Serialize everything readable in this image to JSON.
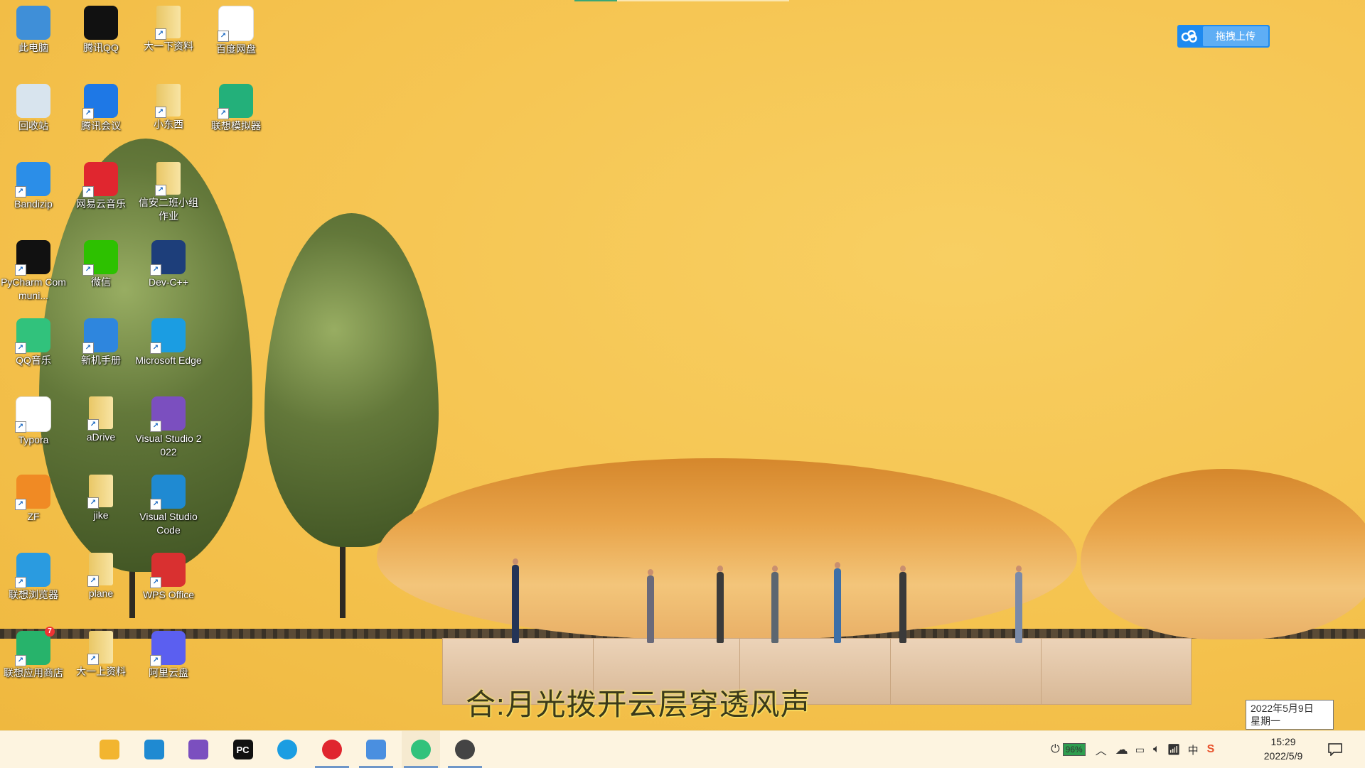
{
  "desktop": {
    "progress_fraction": 0.2,
    "icons": [
      {
        "label": "此电脑",
        "icon": "computer-icon",
        "color": "#3f8fd8"
      },
      {
        "label": "腾讯QQ",
        "icon": "qq-penguin-icon",
        "color": "#111111"
      },
      {
        "label": "大一下资料",
        "icon": "folder-icon",
        "color": "#f3d57c"
      },
      {
        "label": "百度网盘",
        "icon": "baidu-netdisk-icon",
        "color": "#ffffff"
      },
      {
        "label": "回收站",
        "icon": "recycle-bin-icon",
        "color": "#d8e4ee"
      },
      {
        "label": "腾讯会议",
        "icon": "tencent-meeting-icon",
        "color": "#1e78e6"
      },
      {
        "label": "小东西",
        "icon": "folder-icon",
        "color": "#f3d57c"
      },
      {
        "label": "联想模拟器",
        "icon": "lenovo-emulator-icon",
        "color": "#23b07a"
      },
      {
        "label": "Bandizip",
        "icon": "bandizip-icon",
        "color": "#2b8ee8"
      },
      {
        "label": "网易云音乐",
        "icon": "netease-music-icon",
        "color": "#e0262f"
      },
      {
        "label": "信安二班小组作业",
        "icon": "folder-icon",
        "color": "#f3d57c"
      },
      {
        "label": "PyCharm Communi...",
        "icon": "pycharm-icon",
        "color": "#111111"
      },
      {
        "label": "微信",
        "icon": "wechat-icon",
        "color": "#2dc100"
      },
      {
        "label": "Dev-C++",
        "icon": "devcpp-icon",
        "color": "#1d3e7a"
      },
      {
        "label": "QQ音乐",
        "icon": "qq-music-icon",
        "color": "#31c27c"
      },
      {
        "label": "新机手册",
        "icon": "manual-icon",
        "color": "#2e86de"
      },
      {
        "label": "Microsoft Edge",
        "icon": "edge-icon",
        "color": "#1b9de2"
      },
      {
        "label": "Typora",
        "icon": "typora-icon",
        "color": "#ffffff"
      },
      {
        "label": "aDrive",
        "icon": "folder-icon",
        "color": "#f3d57c"
      },
      {
        "label": "Visual Studio 2022",
        "icon": "visual-studio-icon",
        "color": "#7b4fbf"
      },
      {
        "label": "ZF",
        "icon": "zf-icon",
        "color": "#f08a24"
      },
      {
        "label": "jike",
        "icon": "folder-icon",
        "color": "#f3d57c"
      },
      {
        "label": "Visual Studio Code",
        "icon": "vscode-icon",
        "color": "#1f8ad2"
      },
      {
        "label": "联想浏览器",
        "icon": "lenovo-browser-icon",
        "color": "#2a9be0"
      },
      {
        "label": "plane",
        "icon": "folder-icon",
        "color": "#f3d57c"
      },
      {
        "label": "WPS Office",
        "icon": "wps-icon",
        "color": "#d93030"
      },
      {
        "label": "联想应用商店",
        "icon": "lenovo-app-store-icon",
        "color": "#27b36b",
        "badge": "7"
      },
      {
        "label": "大一上资料",
        "icon": "folder-icon",
        "color": "#f3d57c"
      },
      {
        "label": "阿里云盘",
        "icon": "aliyun-drive-icon",
        "color": "#5b5ff0"
      }
    ],
    "lyric": "合:月光拨开云层穿透风声",
    "upload_widget": {
      "label": "拖拽上传",
      "icon": "baidu-cloud-icon",
      "color": "#1e8af0"
    },
    "date_tooltip": {
      "date": "2022年5月9日",
      "weekday": "星期一"
    }
  },
  "taskbar": {
    "items": [
      {
        "name": "start",
        "icon": "windows-start-icon",
        "glyph": "",
        "color": "#111111"
      },
      {
        "name": "search",
        "icon": "search-icon",
        "glyph": "",
        "color": "#111111"
      },
      {
        "name": "file-explorer",
        "icon": "file-explorer-icon",
        "glyph": "",
        "color": "#f2b530"
      },
      {
        "name": "vscode",
        "icon": "vscode-icon",
        "glyph": "",
        "color": "#1f8ad2"
      },
      {
        "name": "visual-studio",
        "icon": "visual-studio-icon",
        "glyph": "",
        "color": "#7b4fbf"
      },
      {
        "name": "pycharm",
        "icon": "pycharm-icon",
        "glyph": "PC",
        "color": "#111111"
      },
      {
        "name": "edge",
        "icon": "edge-icon",
        "glyph": "",
        "color": "#1b9de2"
      },
      {
        "name": "netease-music",
        "icon": "netease-music-icon",
        "glyph": "",
        "color": "#e0262f",
        "running": true
      },
      {
        "name": "baidu-netdisk",
        "icon": "baidu-netdisk-icon",
        "glyph": "",
        "color": "#4a8fe0",
        "running": true
      },
      {
        "name": "qq-music",
        "icon": "qq-music-icon",
        "glyph": "",
        "color": "#31c27c",
        "running": true,
        "active": true
      },
      {
        "name": "recorder",
        "icon": "camera-app-icon",
        "glyph": "",
        "color": "#444444",
        "running": true
      }
    ],
    "tray": {
      "battery_percent": "96%",
      "ime": "中",
      "sogou": "S"
    },
    "clock": {
      "time": "15:29",
      "date": "2022/5/9"
    }
  }
}
